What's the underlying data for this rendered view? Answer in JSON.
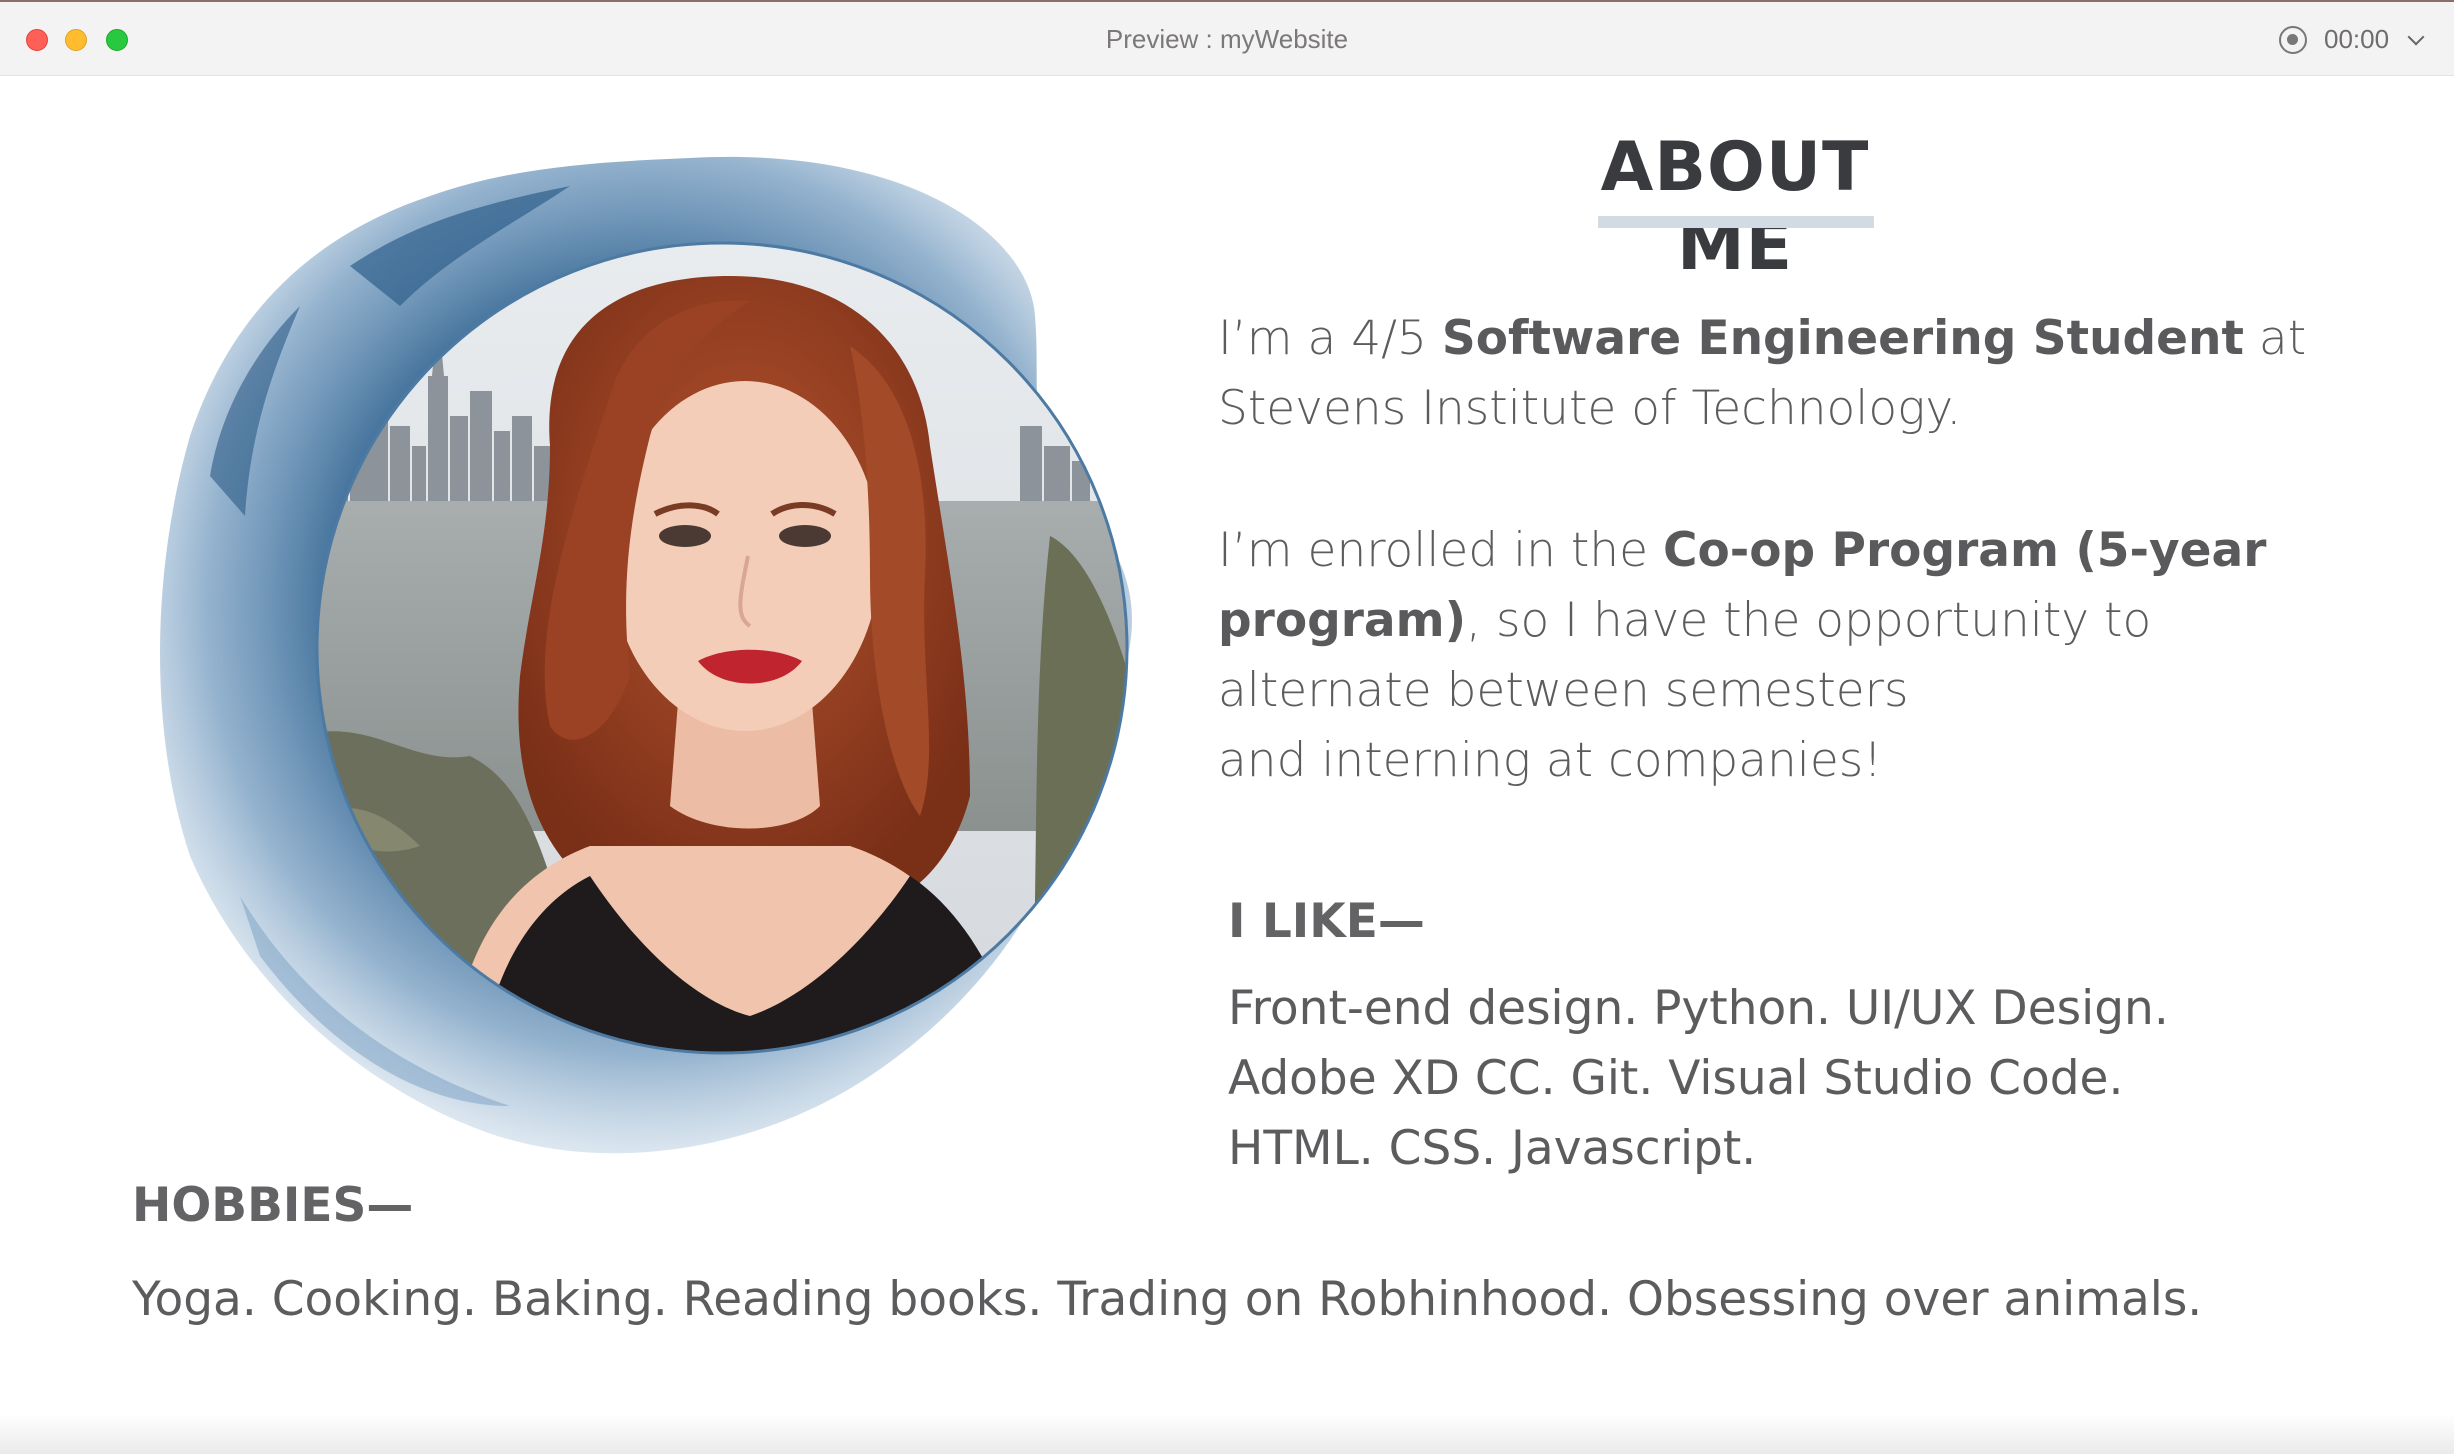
{
  "window": {
    "title": "Preview : myWebsite",
    "timer": "00:00"
  },
  "about": {
    "heading": "ABOUT ME",
    "para1": {
      "pre": "I’m a 4/5 ",
      "bold": "Software Engineering Student",
      "post": " at Stevens Institute of Technology."
    },
    "para2": {
      "pre": "I’m enrolled in the ",
      "bold": "Co-op Program (5-year program)",
      "post": ", so I have the opportunity to alternate between semesters",
      "line_last": "and interning at companies!"
    }
  },
  "likes": {
    "title": "I LIKE—",
    "lines": [
      "Front-end design. Python. UI/UX Design.",
      "Adobe XD CC. Git. Visual Studio Code.",
      "HTML. CSS. Javascript."
    ]
  },
  "hobbies": {
    "title": "HOBBIES—",
    "text": "Yoga. Cooking. Baking. Reading books. Trading on Robhinhood. Obsessing over animals."
  },
  "colors": {
    "accent": "#d0dbe4",
    "watercolor": "#5b89b0",
    "text": "#5c5c5e"
  }
}
